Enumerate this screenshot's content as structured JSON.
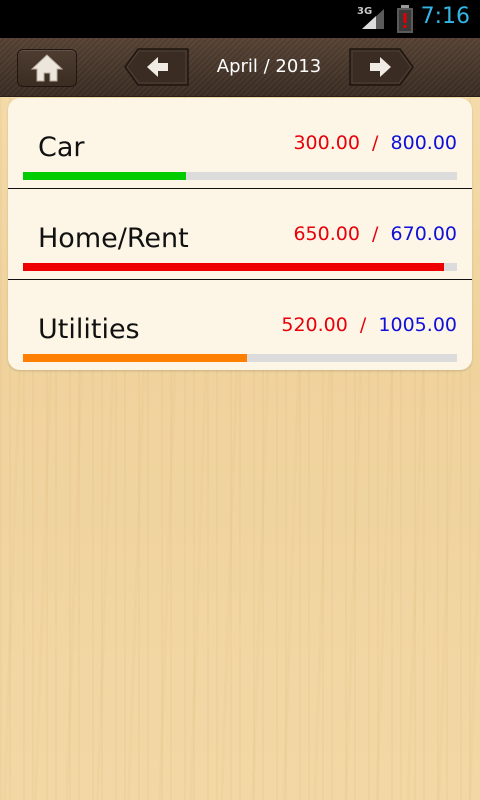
{
  "status_bar": {
    "network": "3G",
    "time": "7:16",
    "time_color": "#33b5e5",
    "battery_alert": "!"
  },
  "header": {
    "period": "April / 2013",
    "home_icon": "home-icon",
    "prev_icon": "arrow-left-icon",
    "next_icon": "arrow-right-icon"
  },
  "budgets": [
    {
      "name": "Car",
      "spent": "300.00",
      "separator": "/",
      "budget": "800.00",
      "progress": 0.375,
      "bar_color": "#00cc00"
    },
    {
      "name": "Home/Rent",
      "spent": "650.00",
      "separator": "/",
      "budget": "670.00",
      "progress": 0.97,
      "bar_color": "#ee0000"
    },
    {
      "name": "Utilities",
      "spent": "520.00",
      "separator": "/",
      "budget": "1005.00",
      "progress": 0.517,
      "bar_color": "#ff8000"
    }
  ],
  "colors": {
    "spent": "#e8000b",
    "budget": "#1010d8",
    "header_bg": "#46362a",
    "card_bg": "#fdf6e6"
  }
}
